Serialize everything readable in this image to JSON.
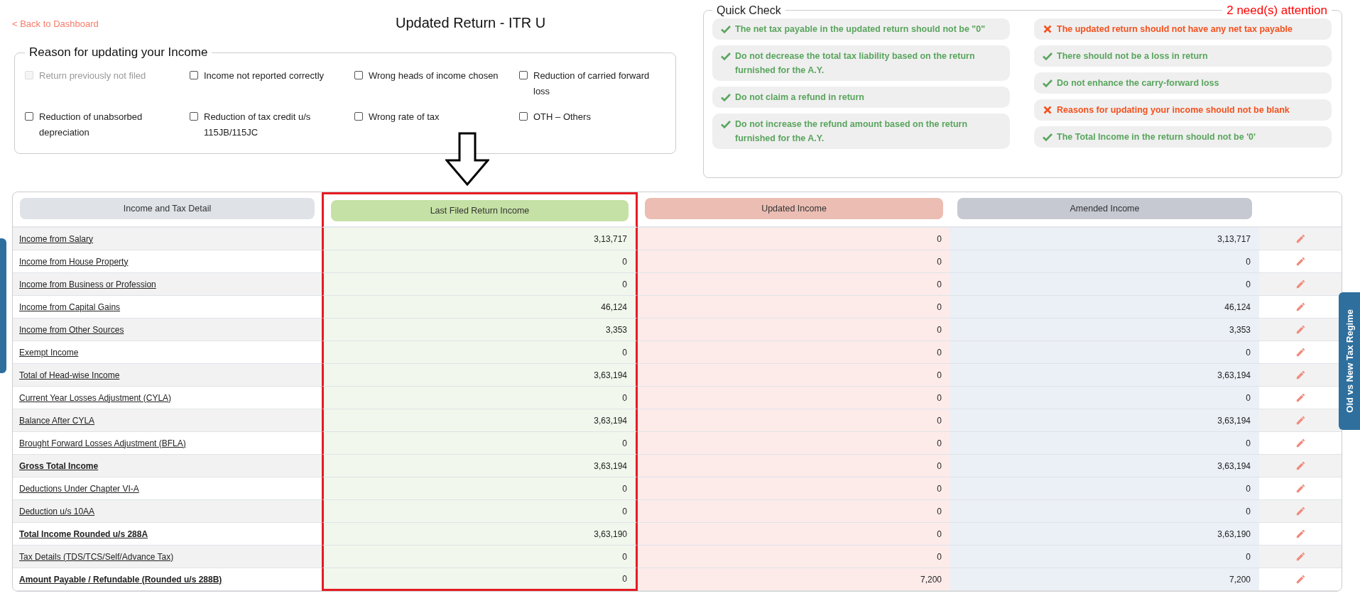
{
  "back_link": "< Back to Dashboard",
  "title": "Updated Return - ITR U",
  "reasons": {
    "legend": "Reason for updating your Income",
    "options": [
      {
        "label": "Return previously not filed",
        "checked": false,
        "disabled": true
      },
      {
        "label": "Income not reported correctly",
        "checked": false,
        "disabled": false
      },
      {
        "label": "Wrong heads of income chosen",
        "checked": false,
        "disabled": false
      },
      {
        "label": "Reduction of carried forward loss",
        "checked": false,
        "disabled": false
      },
      {
        "label": "Reduction of unabsorbed depreciation",
        "checked": false,
        "disabled": false
      },
      {
        "label": "Reduction of tax credit u/s 115JB/115JC",
        "checked": false,
        "disabled": false
      },
      {
        "label": "Wrong rate of tax",
        "checked": false,
        "disabled": false
      },
      {
        "label": "OTH – Others",
        "checked": false,
        "disabled": false
      }
    ]
  },
  "quick_check": {
    "title": "Quick Check",
    "attention": "2 need(s) attention",
    "items_left": [
      {
        "text": "The net tax payable in the updated return should not be \"0\"",
        "passed": true
      },
      {
        "text": "Do not decrease the total tax liability based on the return furnished for the A.Y.",
        "passed": true
      },
      {
        "text": "Do not claim a refund in return",
        "passed": true
      },
      {
        "text": "Do not increase the refund amount based on the return furnished for the A.Y.",
        "passed": true
      }
    ],
    "items_right": [
      {
        "text": "The updated return should not have any net tax payable",
        "passed": false
      },
      {
        "text": "There should not be a loss in return",
        "passed": true
      },
      {
        "text": "Do not enhance the carry-forward loss",
        "passed": true
      },
      {
        "text": "Reasons for updating your income should not be blank",
        "passed": false
      },
      {
        "text": "The Total Income in the return should not be '0'",
        "passed": true
      }
    ]
  },
  "table": {
    "columns": [
      "Income and Tax Detail",
      "Last Filed Return Income",
      "Updated Income",
      "Amended Income"
    ],
    "rows": [
      {
        "label": "Income from Salary",
        "bold": false,
        "last_filed": "3,13,717",
        "updated": "0",
        "amended": "3,13,717"
      },
      {
        "label": "Income from House Property",
        "bold": false,
        "last_filed": "0",
        "updated": "0",
        "amended": "0"
      },
      {
        "label": "Income from Business or Profession",
        "bold": false,
        "last_filed": "0",
        "updated": "0",
        "amended": "0"
      },
      {
        "label": "Income from Capital Gains",
        "bold": false,
        "last_filed": "46,124",
        "updated": "0",
        "amended": "46,124"
      },
      {
        "label": "Income from Other Sources",
        "bold": false,
        "last_filed": "3,353",
        "updated": "0",
        "amended": "3,353"
      },
      {
        "label": "Exempt Income",
        "bold": false,
        "last_filed": "0",
        "updated": "0",
        "amended": "0"
      },
      {
        "label": "Total of Head-wise Income",
        "bold": false,
        "last_filed": "3,63,194",
        "updated": "0",
        "amended": "3,63,194"
      },
      {
        "label": "Current Year Losses Adjustment (CYLA)",
        "bold": false,
        "last_filed": "0",
        "updated": "0",
        "amended": "0"
      },
      {
        "label": "Balance After CYLA",
        "bold": false,
        "last_filed": "3,63,194",
        "updated": "0",
        "amended": "3,63,194"
      },
      {
        "label": "Brought Forward Losses Adjustment (BFLA)",
        "bold": false,
        "last_filed": "0",
        "updated": "0",
        "amended": "0"
      },
      {
        "label": "Gross Total Income",
        "bold": true,
        "last_filed": "3,63,194",
        "updated": "0",
        "amended": "3,63,194"
      },
      {
        "label": "Deductions Under Chapter VI-A",
        "bold": false,
        "last_filed": "0",
        "updated": "0",
        "amended": "0"
      },
      {
        "label": "Deduction u/s 10AA",
        "bold": false,
        "last_filed": "0",
        "updated": "0",
        "amended": "0"
      },
      {
        "label": "Total Income Rounded u/s 288A",
        "bold": true,
        "last_filed": "3,63,190",
        "updated": "0",
        "amended": "3,63,190"
      },
      {
        "label": "Tax Details (TDS/TCS/Self/Advance Tax)",
        "bold": false,
        "last_filed": "0",
        "updated": "0",
        "amended": "0"
      },
      {
        "label": "Amount Payable / Refundable (Rounded u/s 288B)",
        "bold": true,
        "last_filed": "0",
        "updated": "7,200",
        "amended": "7,200"
      }
    ]
  },
  "side_tab": "Old vs New Tax Regime"
}
